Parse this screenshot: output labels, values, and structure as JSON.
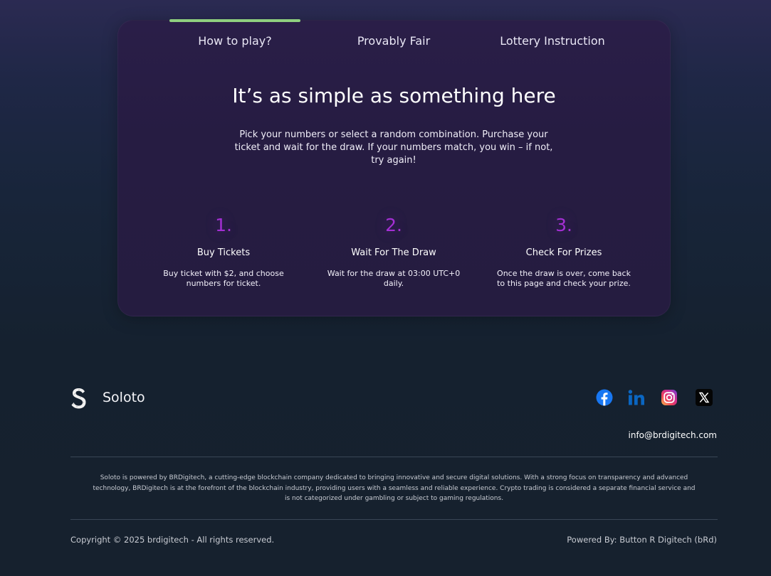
{
  "tabs": {
    "items": [
      {
        "label": "How to play?",
        "active": true
      },
      {
        "label": "Provably Fair",
        "active": false
      },
      {
        "label": "Lottery Instruction",
        "active": false
      }
    ],
    "active_color": "#8fd07f"
  },
  "how_to_play": {
    "headline": "It’s as simple as something here",
    "intro": "Pick your numbers or select a random combination. Purchase your ticket and wait for the draw. If your numbers match, you win – if not, try again!",
    "steps": [
      {
        "number": "1.",
        "title": "Buy Tickets",
        "description": "Buy ticket with $2, and choose numbers for ticket."
      },
      {
        "number": "2.",
        "title": "Wait For The Draw",
        "description": "Wait for the draw at 03:00 UTC+0 daily."
      },
      {
        "number": "3.",
        "title": "Check For Prizes",
        "description": "Once the draw is over, come back to this page and check your prize."
      }
    ],
    "step_number_color": "#a42fd4"
  },
  "footer": {
    "brand": "Soloto",
    "social_icons": [
      "facebook-icon",
      "linkedin-icon",
      "instagram-icon",
      "x-twitter-icon"
    ],
    "email": "info@brdigitech.com",
    "disclaimer": "Soloto is powered by BRDigitech, a cutting-edge blockchain company dedicated to bringing innovative and secure digital solutions. With a strong focus on transparency and advanced technology, BRDigitech is at the forefront of the blockchain industry, providing users with a seamless and reliable experience. Crypto trading is considered a separate financial service and is not categorized under gambling or subject to gaming regulations.",
    "copyright": "Copyright © 2025 brdigitech - All rights reserved.",
    "powered_by": "Powered By: Button R Digitech (bRd)"
  },
  "colors": {
    "background": "#16212e",
    "panel": "#261c42",
    "facebook": "#1877f2",
    "linkedin": "#0a66c2"
  }
}
